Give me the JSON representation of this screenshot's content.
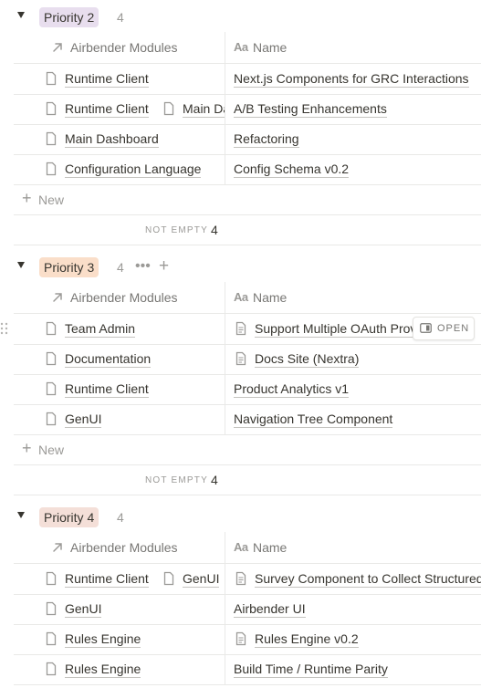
{
  "colors": {
    "priority_2": "#e8deee",
    "priority_3": "#fadec9",
    "priority_4": "#f4dfd8",
    "border": "#e9e9e7",
    "muted": "#9b9a97"
  },
  "columns": {
    "relation": "Airbender Modules",
    "title": "Name",
    "relation_icon": "arrow-up-right-icon",
    "title_icon": "text-aa-icon"
  },
  "groups": [
    {
      "label": "Priority 2",
      "count": "4",
      "rows": [
        {
          "modules": [
            "Runtime Client"
          ],
          "name": "Next.js Components for GRC Interactions",
          "name_has_page_icon": false
        },
        {
          "modules": [
            "Runtime Client",
            "Main Dashboard"
          ],
          "name": "A/B Testing Enhancements",
          "name_has_page_icon": false
        },
        {
          "modules": [
            "Main Dashboard"
          ],
          "name": "Refactoring",
          "name_has_page_icon": false
        },
        {
          "modules": [
            "Configuration Language"
          ],
          "name": "Config Schema v0.2",
          "name_has_page_icon": false
        }
      ],
      "new_label": "New",
      "calc_label": "NOT EMPTY",
      "calc_value": "4"
    },
    {
      "label": "Priority 3",
      "count": "4",
      "rows": [
        {
          "modules": [
            "Team Admin"
          ],
          "name": "Support Multiple OAuth Providers",
          "name_has_page_icon": true,
          "open_label": "OPEN"
        },
        {
          "modules": [
            "Documentation"
          ],
          "name": "Docs Site (Nextra)",
          "name_has_page_icon": true
        },
        {
          "modules": [
            "Runtime Client"
          ],
          "name": "Product Analytics v1",
          "name_has_page_icon": false
        },
        {
          "modules": [
            "GenUI"
          ],
          "name": "Navigation Tree Component",
          "name_has_page_icon": false
        }
      ],
      "new_label": "New",
      "calc_label": "NOT EMPTY",
      "calc_value": "4"
    },
    {
      "label": "Priority 4",
      "count": "4",
      "rows": [
        {
          "modules": [
            "Runtime Client",
            "GenUI"
          ],
          "name": "Survey Component to Collect Structured Feedback",
          "name_has_page_icon": true
        },
        {
          "modules": [
            "GenUI"
          ],
          "name": "Airbender UI",
          "name_has_page_icon": false
        },
        {
          "modules": [
            "Rules Engine"
          ],
          "name": "Rules Engine v0.2",
          "name_has_page_icon": true
        },
        {
          "modules": [
            "Rules Engine"
          ],
          "name": "Build Time / Runtime Parity",
          "name_has_page_icon": false
        }
      ]
    }
  ]
}
